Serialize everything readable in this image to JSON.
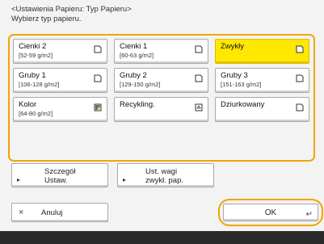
{
  "header": {
    "title": "<Ustawienia Papieru: Typ Papieru>",
    "subtitle": "Wybierz typ papieru."
  },
  "paper_types": [
    {
      "name": "Cienki 2",
      "sub": "[52-59 g/m2]",
      "icon": "paper-icon",
      "selected": false
    },
    {
      "name": "Cienki 1",
      "sub": "[60-63 g/m2]",
      "icon": "paper-icon",
      "selected": false
    },
    {
      "name": "Zwykły",
      "sub": "",
      "icon": "paper-icon",
      "selected": true
    },
    {
      "name": "Gruby 1",
      "sub": "[106-128 g/m2]",
      "icon": "paper-icon",
      "selected": false
    },
    {
      "name": "Gruby 2",
      "sub": "[129-150 g/m2]",
      "icon": "paper-icon",
      "selected": false
    },
    {
      "name": "Gruby 3",
      "sub": "[151-163 g/m2]",
      "icon": "paper-icon",
      "selected": false
    },
    {
      "name": "Kolor",
      "sub": "[64-80 g/m2]",
      "icon": "color-paper-icon",
      "selected": false
    },
    {
      "name": "Recykling.",
      "sub": "",
      "icon": "recycled-paper-icon",
      "selected": false
    },
    {
      "name": "Dziurkowany",
      "sub": "",
      "icon": "paper-icon",
      "selected": false
    }
  ],
  "actions": {
    "details_line1": "Szczegół",
    "details_line2": "Ustaw.",
    "weight_line1": "Ust. wagi",
    "weight_line2": "zwykł. pap.",
    "cancel_label": "Anuluj",
    "ok_label": "OK"
  },
  "colors": {
    "accent": "#f0a500",
    "selected": "#ffe800"
  }
}
